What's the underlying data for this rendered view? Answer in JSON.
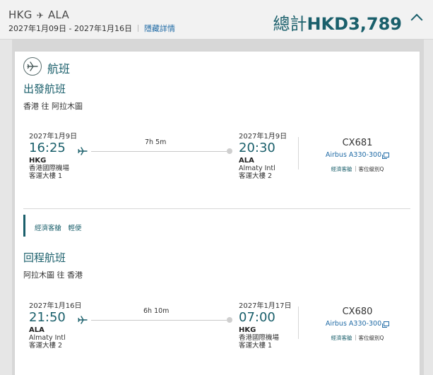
{
  "header": {
    "origin": "HKG",
    "destination": "ALA",
    "date_range": "2027年1月09日 - 2027年1月16日",
    "hide_details": "隱藏詳情",
    "total_label": "總計",
    "total_amount": "HKD3,789",
    "icons": [
      "plane-icon",
      "chevron-up-icon"
    ]
  },
  "section": {
    "title": "航班",
    "icon": "plane-circle-icon"
  },
  "outbound": {
    "title": "出發航班",
    "route": "香港 往 阿拉木圖",
    "dep_date": "2027年1月9日",
    "dep_time": "16:25",
    "dep_code": "HKG",
    "dep_airport": "香港國際機場",
    "dep_terminal": "客運大樓 1",
    "duration": "7h 5m",
    "arr_date": "2027年1月9日",
    "arr_time": "20:30",
    "arr_code": "ALA",
    "arr_airport": "Almaty Intl",
    "arr_terminal": "客運大樓 2",
    "flight_no": "CX681",
    "aircraft": "Airbus A330-300",
    "cabin": "經濟客艙",
    "booking_class": "客位級別Q"
  },
  "fare_summary": {
    "text": "經濟客艙　輕便"
  },
  "inbound": {
    "title": "回程航班",
    "route": "阿拉木圖 往 香港",
    "dep_date": "2027年1月16日",
    "dep_time": "21:50",
    "dep_code": "ALA",
    "dep_airport": "Almaty Intl",
    "dep_terminal": "客運大樓 2",
    "duration": "6h 10m",
    "arr_date": "2027年1月17日",
    "arr_time": "07:00",
    "arr_code": "HKG",
    "arr_airport": "香港國際機場",
    "arr_terminal": "客運大樓 1",
    "flight_no": "CX680",
    "aircraft": "Airbus A330-300",
    "cabin": "經濟客艙",
    "booking_class": "客位級別Q"
  },
  "colors": {
    "accent": "#1a5f6b",
    "link": "#1f6aa5",
    "background": "#e6e6e6"
  }
}
